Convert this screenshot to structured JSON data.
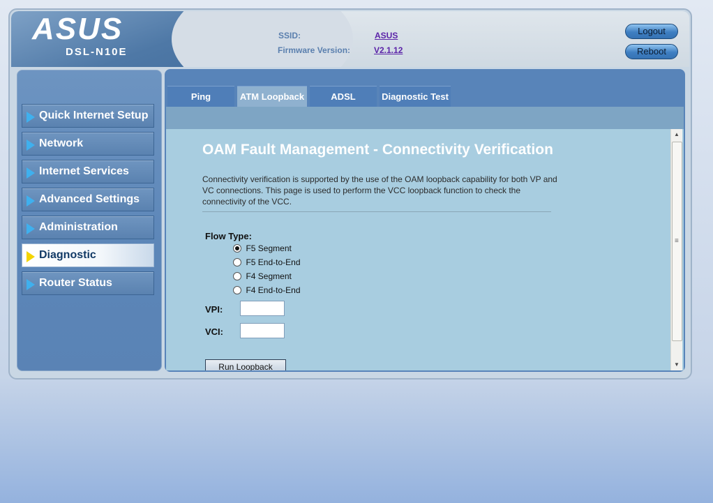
{
  "header": {
    "logo_text": "ASUS",
    "model": "DSL-N10E",
    "ssid_label": "SSID:",
    "ssid_value": "ASUS",
    "firmware_label": "Firmware Version:",
    "firmware_value": "V2.1.12",
    "logout_label": "Logout",
    "reboot_label": "Reboot"
  },
  "sidebar": {
    "items": [
      {
        "label": "Quick Internet Setup"
      },
      {
        "label": "Network"
      },
      {
        "label": "Internet Services"
      },
      {
        "label": "Advanced Settings"
      },
      {
        "label": "Administration"
      },
      {
        "label": "Diagnostic",
        "active": true
      },
      {
        "label": "Router Status"
      }
    ]
  },
  "tabs": [
    {
      "label": "Ping"
    },
    {
      "label": "ATM Loopback",
      "active": true
    },
    {
      "label": "ADSL"
    },
    {
      "label": "Diagnostic Test"
    }
  ],
  "main": {
    "title": "OAM Fault Management - Connectivity Verification",
    "description": "Connectivity verification is supported by the use of the OAM loopback capability for both VP and VC connections. This page is used to perform the VCC loopback function to check the connectivity of the VCC.",
    "flow_type_label": "Flow Type:",
    "flow_options": [
      {
        "label": "F5 Segment",
        "checked": true
      },
      {
        "label": "F5 End-to-End",
        "checked": false
      },
      {
        "label": "F4 Segment",
        "checked": false
      },
      {
        "label": "F4 End-to-End",
        "checked": false
      }
    ],
    "vpi_label": "VPI:",
    "vpi_value": "",
    "vci_label": "VCI:",
    "vci_value": "",
    "run_button_label": "Run Loopback"
  },
  "colors": {
    "accent": "#5884b9",
    "content_bg": "#a8cde0",
    "link": "#5b23a8",
    "active_arrow": "#f4d400",
    "menu_arrow": "#3fb0ee"
  }
}
